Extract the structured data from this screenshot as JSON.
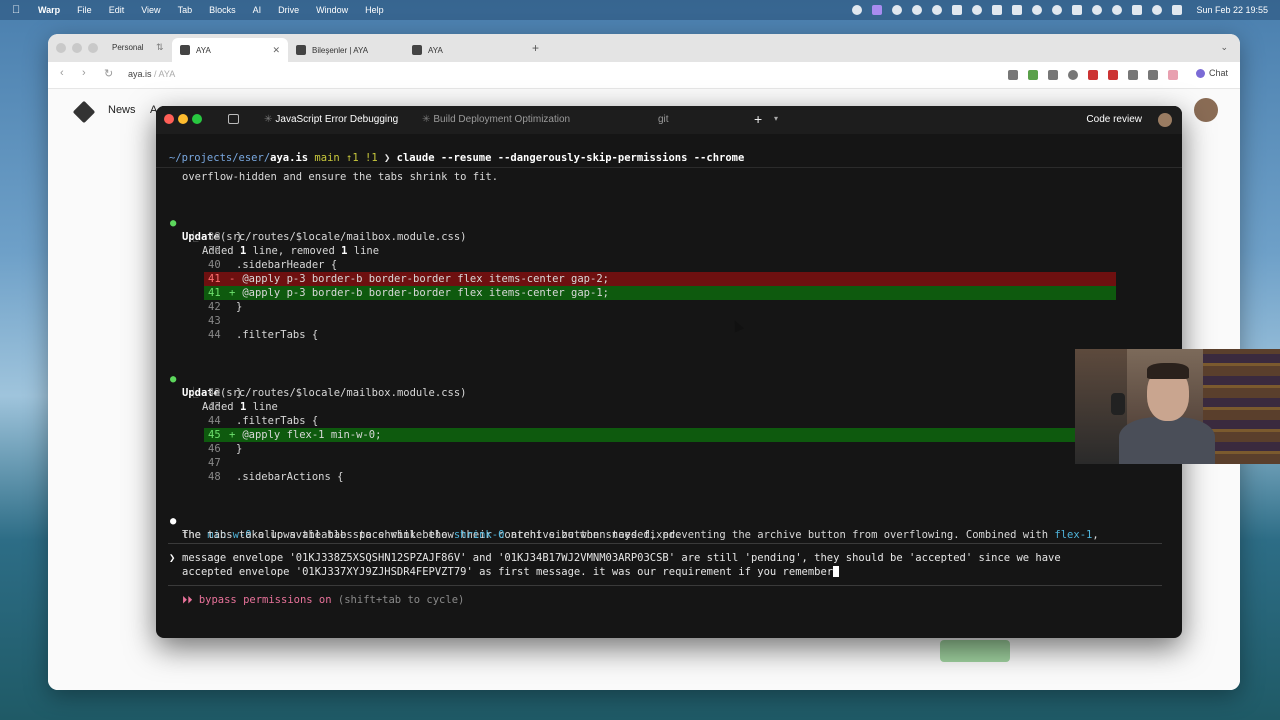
{
  "menubar": {
    "app": "Warp",
    "items": [
      "File",
      "Edit",
      "View",
      "Tab",
      "Blocks",
      "AI",
      "Drive",
      "Window",
      "Help"
    ],
    "clock": "Sun Feb 22  19:55"
  },
  "browser": {
    "profile": "Personal",
    "tabs": [
      {
        "label": "AYA",
        "active": true
      },
      {
        "label": "Bileşenler | AYA",
        "active": false
      },
      {
        "label": "AYA",
        "active": false
      }
    ],
    "url": "aya.is",
    "url_faint": " / AYA",
    "chat_label": "Chat",
    "page": {
      "nav_news": "News",
      "nav_partial": "A"
    }
  },
  "warp": {
    "tabs": [
      {
        "label": "JavaScript Error Debugging",
        "active": true
      },
      {
        "label": "Build Deployment Optimization",
        "active": false
      },
      {
        "label": "git",
        "active": false
      }
    ],
    "code_review": "Code review",
    "prompt": {
      "path": "~/projects/eser/",
      "repo": "aya.is",
      "branch": "main ↑1 !1",
      "arrow": "❯",
      "command": "claude --resume --dangerously-skip-permissions --chrome"
    },
    "partial_line": "overflow-hidden and ensure the tabs shrink to fit.",
    "update1": {
      "verb": "Update",
      "file": "(src/routes/$locale/mailbox.module.css)",
      "summary_a": "Added ",
      "summary_b": "1",
      "summary_c": " line, removed ",
      "summary_d": "1",
      "summary_e": " line",
      "lines": [
        {
          "n": "38",
          "m": "",
          "code": "}"
        },
        {
          "n": "39",
          "m": "",
          "code": ""
        },
        {
          "n": "40",
          "m": "",
          "code": ".sidebarHeader {"
        },
        {
          "n": "41",
          "m": "-",
          "code": " @apply p-3 border-b border-border flex items-center gap-2;"
        },
        {
          "n": "41",
          "m": "+",
          "code": " @apply p-3 border-b border-border flex items-center gap-1;"
        },
        {
          "n": "42",
          "m": "",
          "code": "}"
        },
        {
          "n": "43",
          "m": "",
          "code": ""
        },
        {
          "n": "44",
          "m": "",
          "code": ".filterTabs {"
        }
      ]
    },
    "update2": {
      "verb": "Update",
      "file": "(src/routes/$locale/mailbox.module.css)",
      "summary_a": "Added ",
      "summary_b": "1",
      "summary_c": " line",
      "lines": [
        {
          "n": "42",
          "m": "",
          "code": "}"
        },
        {
          "n": "43",
          "m": "",
          "code": ""
        },
        {
          "n": "44",
          "m": "",
          "code": ".filterTabs {"
        },
        {
          "n": "45",
          "m": "+",
          "code": " @apply flex-1 min-w-0;"
        },
        {
          "n": "46",
          "m": "",
          "code": "}"
        },
        {
          "n": "47",
          "m": "",
          "code": ""
        },
        {
          "n": "48",
          "m": "",
          "code": ".sidebarActions {"
        }
      ]
    },
    "summary": {
      "p1": "The ",
      "h1": "min-w-0",
      "p2": " allows the tabs to shrink below their content size when needed, preventing the archive button from overflowing. Combined with ",
      "h2": "flex-1",
      "p3": ",",
      "p4": "the tabs take up available space while the ",
      "h3": "shrink-0",
      "p5": " archive button stays fixed."
    },
    "input": {
      "caret": "❯",
      "line1": "message envelope '01KJ338Z5XSQSHN12SPZAJF86V' and '01KJ34B17WJ2VMNM03ARP03CSB' are still 'pending', they should be 'accepted' since we have",
      "line2": "accepted envelope '01KJ337XYJ9ZJHSDR4FEPVZT79' as first message. it was our requirement if you remember"
    },
    "mode": {
      "marker": "⏵⏵",
      "label": "bypass permissions on",
      "hint": " (shift+tab to cycle)"
    }
  }
}
